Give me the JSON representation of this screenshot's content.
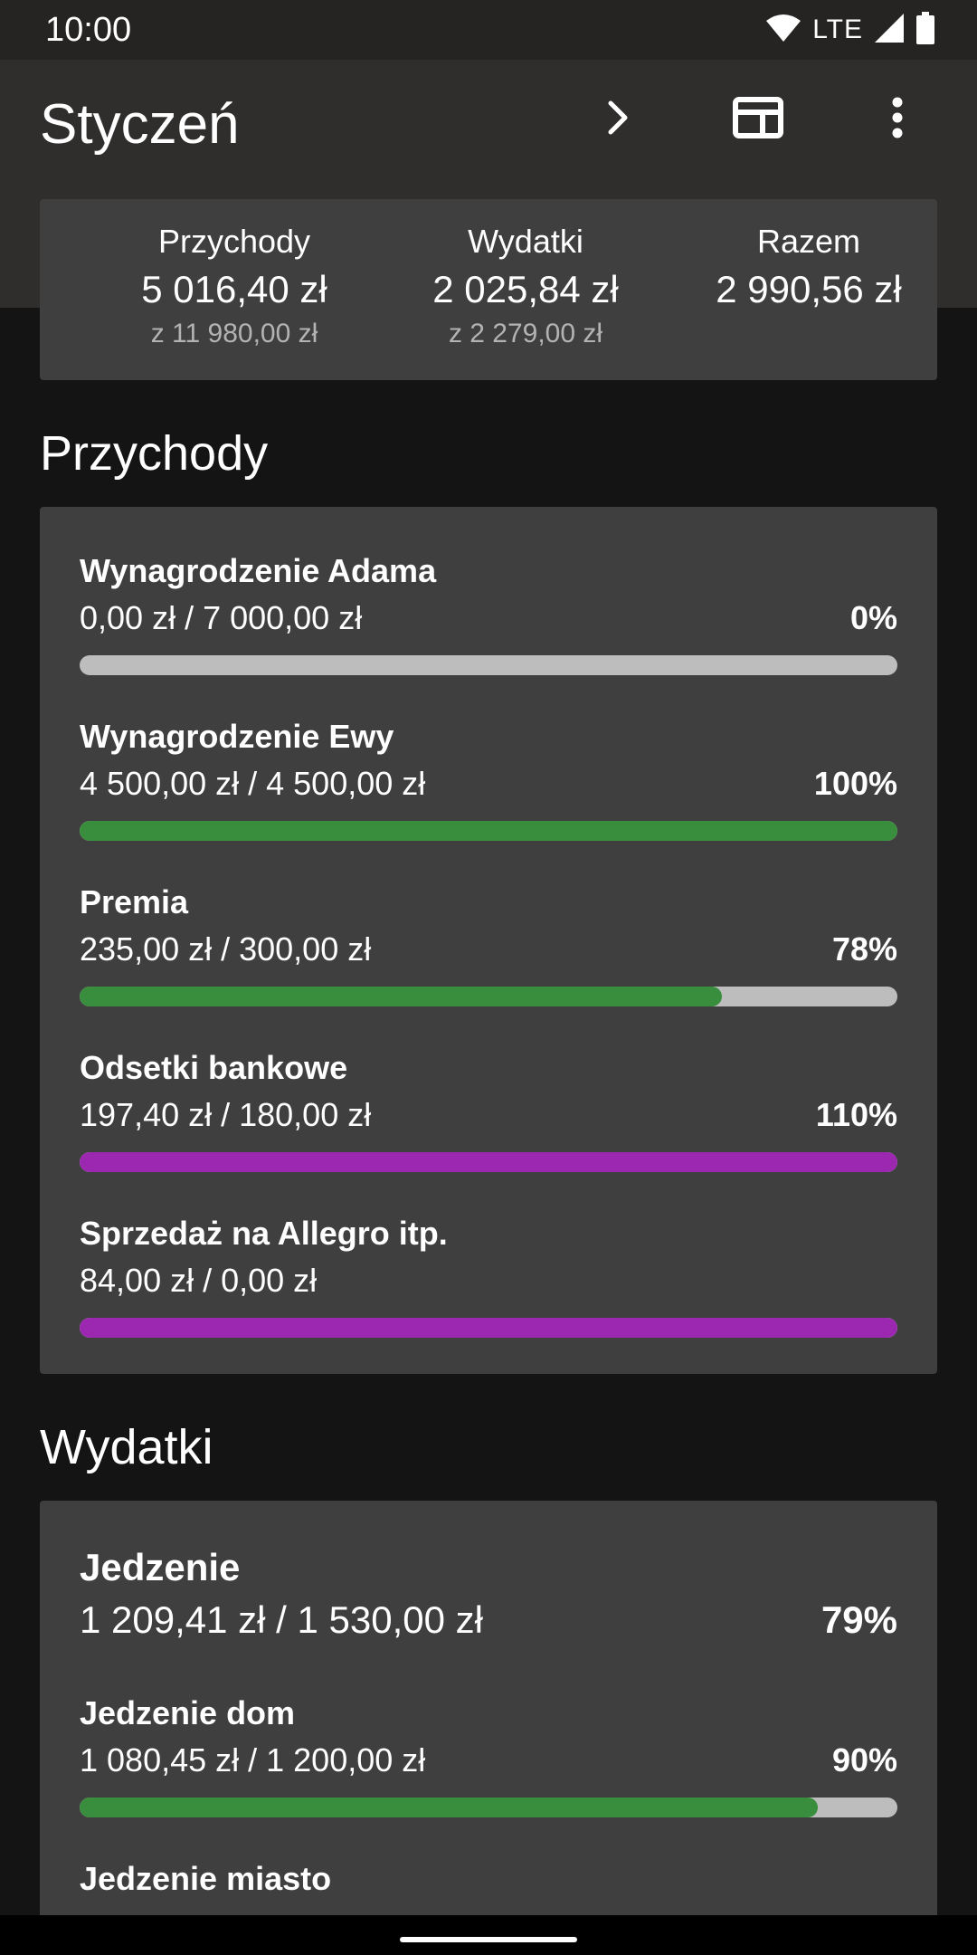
{
  "status_bar": {
    "time": "10:00",
    "network": "LTE"
  },
  "app_bar": {
    "title": "Styczeń",
    "icons": [
      "chevron-right-icon",
      "view-toggle-icon",
      "more-vert-icon"
    ]
  },
  "summary": {
    "income": {
      "label": "Przychody",
      "amount": "5 016,40 zł",
      "sub": "z 11 980,00 zł"
    },
    "expenses": {
      "label": "Wydatki",
      "amount": "2 025,84 zł",
      "sub": "z 2 279,00 zł"
    },
    "total": {
      "label": "Razem",
      "amount": "2 990,56 zł"
    }
  },
  "income_section": {
    "title": "Przychody",
    "items": [
      {
        "name": "Wynagrodzenie Adama",
        "amount": "0,00 zł / 7 000,00 zł",
        "percent": "0%",
        "progress": 0,
        "color": "#388e3c"
      },
      {
        "name": "Wynagrodzenie Ewy",
        "amount": "4 500,00 zł / 4 500,00 zł",
        "percent": "100%",
        "progress": 1.0,
        "color": "#388e3c"
      },
      {
        "name": "Premia",
        "amount": "235,00 zł / 300,00 zł",
        "percent": "78%",
        "progress": 0.785,
        "color": "#388e3c"
      },
      {
        "name": "Odsetki bankowe",
        "amount": "197,40 zł / 180,00 zł",
        "percent": "110%",
        "progress": 1.0,
        "color": "#9c27b0"
      },
      {
        "name": "Sprzedaż na Allegro itp.",
        "amount": "84,00 zł / 0,00 zł",
        "percent": "",
        "progress": 1.0,
        "color": "#9c27b0"
      }
    ]
  },
  "expense_section": {
    "title": "Wydatki",
    "group": {
      "name": "Jedzenie",
      "amount": "1 209,41 zł / 1 530,00 zł",
      "percent": "79%"
    },
    "items": [
      {
        "name": "Jedzenie dom",
        "amount": "1 080,45 zł / 1 200,00 zł",
        "percent": "90%",
        "progress": 0.903,
        "color": "#388e3c"
      },
      {
        "name": "Jedzenie miasto"
      }
    ]
  },
  "colors": {
    "positive": "#388e3c",
    "over": "#9c27b0",
    "track": "#bdbdbd",
    "card": "#3f3f3f",
    "appbar": "#302e2d"
  }
}
